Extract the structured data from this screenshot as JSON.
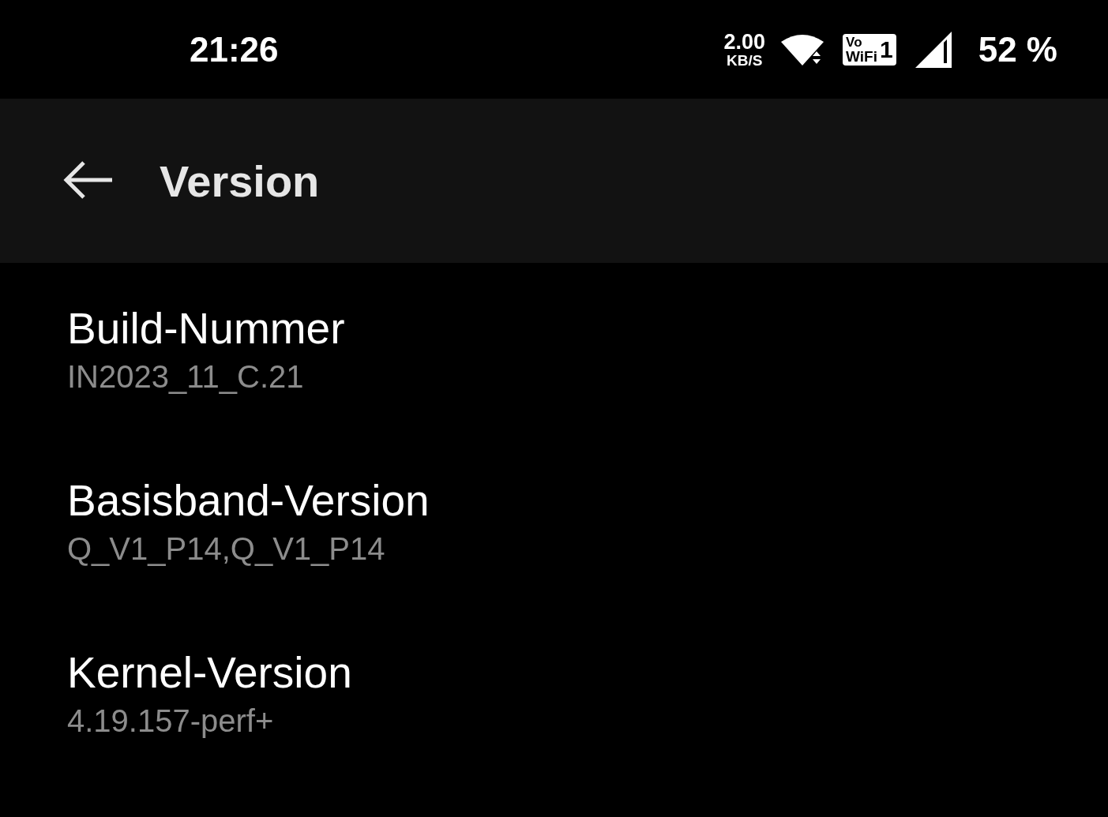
{
  "status_bar": {
    "time": "21:26",
    "speed_value": "2.00",
    "speed_unit": "KB/S",
    "vowifi_top": "Vo",
    "vowifi_bottom": "WiFi",
    "vowifi_slot": "1",
    "battery": "52 %"
  },
  "app_bar": {
    "title": "Version"
  },
  "items": [
    {
      "title": "Build-Nummer",
      "value": "IN2023_11_C.21"
    },
    {
      "title": "Basisband-Version",
      "value": "Q_V1_P14,Q_V1_P14"
    },
    {
      "title": "Kernel-Version",
      "value": "4.19.157-perf+"
    }
  ]
}
